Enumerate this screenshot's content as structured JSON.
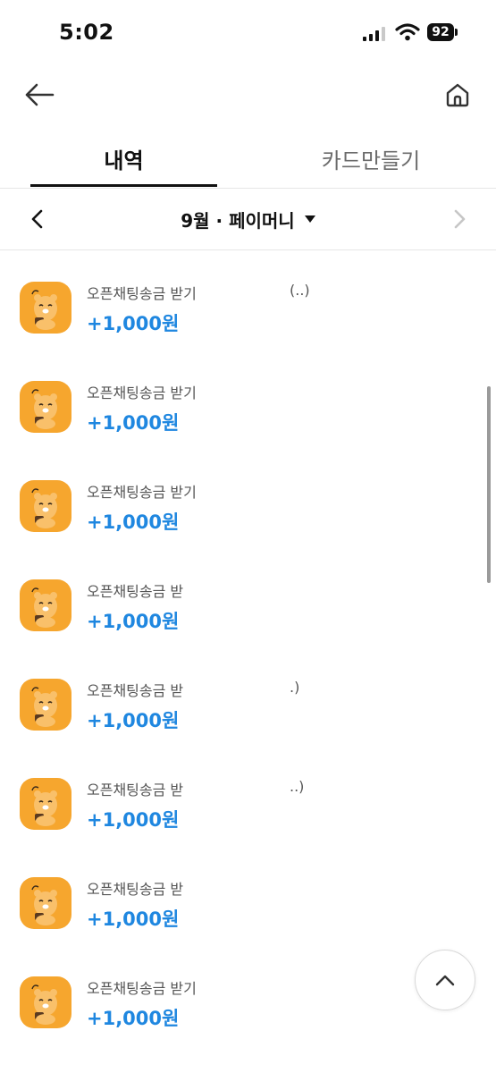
{
  "status_bar": {
    "time": "5:02",
    "battery": "92"
  },
  "icons": {
    "back": "arrow-left-icon",
    "home": "home-icon",
    "prev": "chevron-left-icon",
    "next": "chevron-right-icon",
    "dropdown": "caret-down-icon",
    "scroll_top": "chevron-up-icon",
    "avatar": "ryan-character-icon"
  },
  "tabs": [
    {
      "label": "내역",
      "active": true
    },
    {
      "label": "카드만들기",
      "active": false
    }
  ],
  "month_bar": {
    "label": "9월 · 페이머니"
  },
  "transactions": [
    {
      "title": "오픈채팅송금 받기 ",
      "extra": "(..)",
      "amount": "+1,000원"
    },
    {
      "title": "오픈채팅송금 받기 ",
      "extra": "",
      "amount": "+1,000원"
    },
    {
      "title": "오픈채팅송금 받기 ",
      "extra": "",
      "amount": "+1,000원"
    },
    {
      "title": "오픈채팅송금 받",
      "extra": "",
      "amount": "+1,000원"
    },
    {
      "title": "오픈채팅송금 받",
      "extra": ".)",
      "amount": "+1,000원"
    },
    {
      "title": "오픈채팅송금 받",
      "extra": "..)",
      "amount": "+1,000원"
    },
    {
      "title": "오픈채팅송금 받",
      "extra": "",
      "amount": "+1,000원"
    },
    {
      "title": "오픈채팅송금 받기",
      "extra": "",
      "amount": "+1,000원"
    }
  ],
  "colors": {
    "amount_blue": "#1f87e0",
    "avatar_orange": "#f6a62e",
    "text_dark": "#111111",
    "text_gray": "#555555"
  }
}
